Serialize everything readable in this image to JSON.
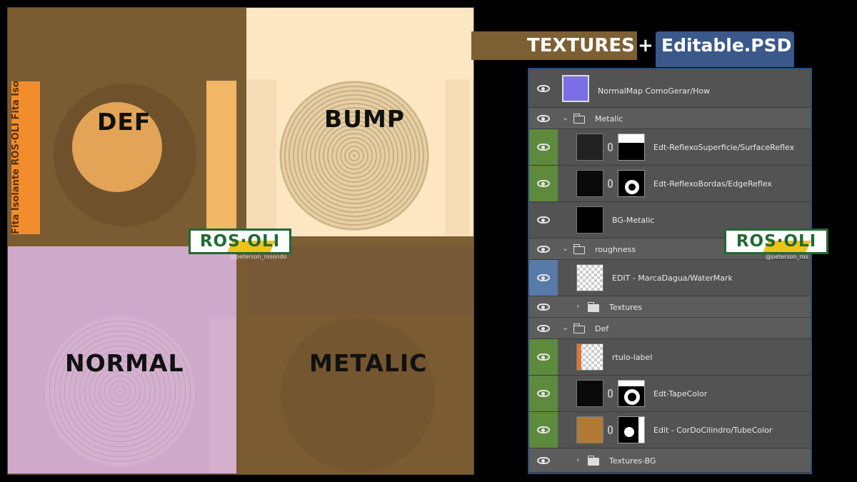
{
  "atlas": {
    "labels": {
      "def": "DEF",
      "bump": "BUMP",
      "normal": "NORMAL",
      "metalic": "METALIC"
    },
    "tape_text": "Fita Isolante  ROS·OLI  Fita Isolante  ROS·OLI"
  },
  "watermark": {
    "brand": "ROS·OLI",
    "handle": "@peterson_rosondo",
    "handle_right": "@peterson_ros"
  },
  "header": {
    "textures": "TEXTURES",
    "plus": "+",
    "psd": "Editable.PSD"
  },
  "layers": [
    {
      "name": "NormalMap ComoGerar/How"
    },
    {
      "name": "Metalic"
    },
    {
      "name": "Edt-ReflexoSuperficie/SurfaceReflex"
    },
    {
      "name": "Edt-ReflexoBordas/EdgeReflex"
    },
    {
      "name": "BG-Metalic"
    },
    {
      "name": "roughness"
    },
    {
      "name": "EDIT - MarcaDagua/WaterMark"
    },
    {
      "name": "Textures"
    },
    {
      "name": "Def"
    },
    {
      "name": "rtulo-label"
    },
    {
      "name": "Edt-TapeColor"
    },
    {
      "name": "Edit - CorDoCilindro/TubeColor"
    },
    {
      "name": "Textures-BG"
    }
  ],
  "colors": {
    "atlas_bg": "#7d5f34",
    "bump": "#fde6c2",
    "normal": "#cfa9c9",
    "tape": "#f28d2e",
    "tube": "#b07a34",
    "eye_green": "#5d8a3d",
    "eye_blue": "#587aa8",
    "psd_blue": "#3a5889"
  }
}
